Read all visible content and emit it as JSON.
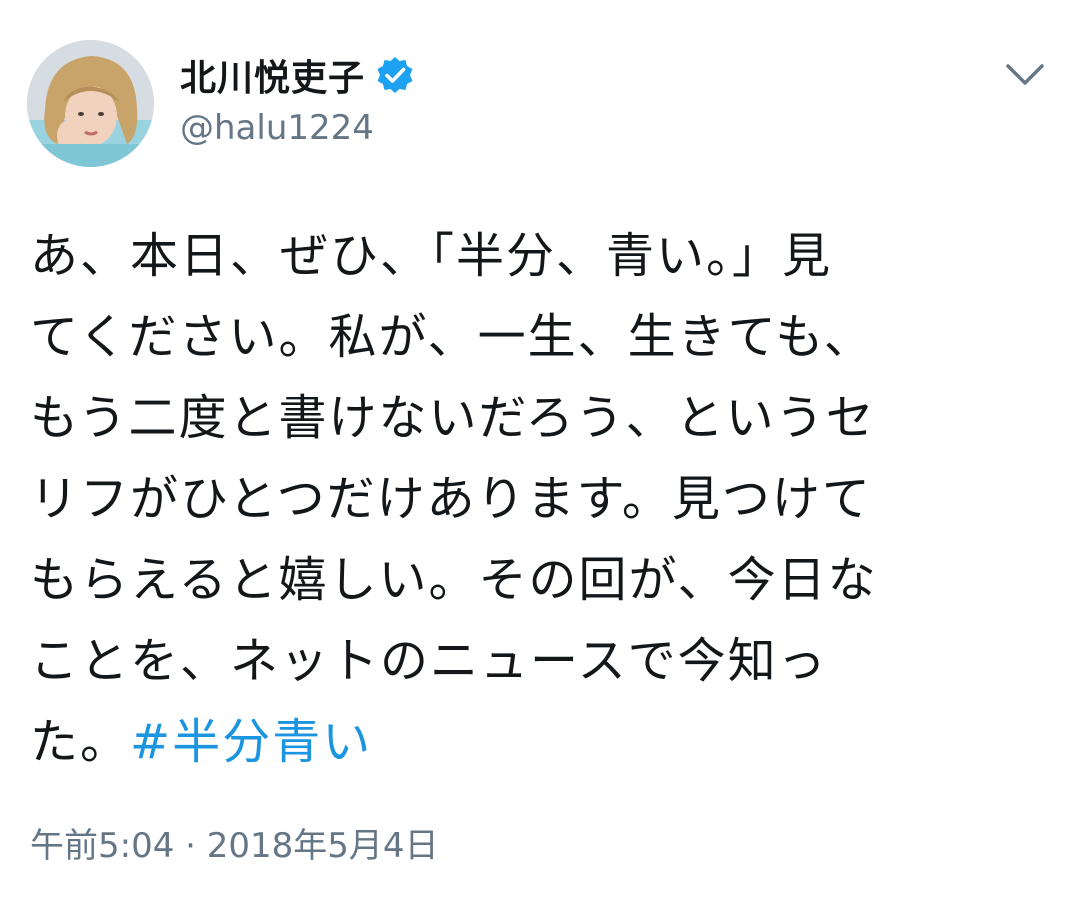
{
  "author": {
    "display_name": "北川悦吏子",
    "handle": "@halu1224",
    "verified": true,
    "avatar_icon": "avatar-photo"
  },
  "menu": {
    "icon": "chevron-down-icon"
  },
  "tweet": {
    "lines": [
      "あ、本日、ぜひ、「半分、青い。」見",
      "てください。私が、一生、生きても、",
      "もう二度と書けないだろう、というセ",
      "リフがひとつだけあります。見つけて",
      "もらえると嬉しい。その回が、今日な",
      "ことを、ネットのニュースで今知っ"
    ],
    "last_line_prefix": "た。",
    "hashtag": "#半分青い"
  },
  "timestamp": "午前5:04 · 2018年5月4日",
  "colors": {
    "text": "#14171a",
    "secondary": "#657786",
    "link": "#1b95e0",
    "verified": "#1da1f2"
  }
}
